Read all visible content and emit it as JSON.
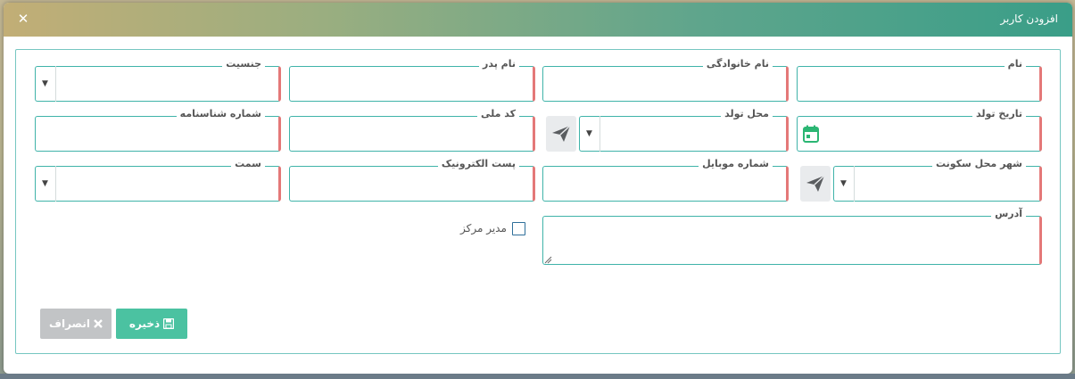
{
  "modal": {
    "title": "افزودن کاربر",
    "close_glyph": "✕"
  },
  "fields": {
    "first_name": "نام",
    "last_name": "نام خانوادگی",
    "father_name": "نام پدر",
    "gender": "جنسیت",
    "birth_date": "تاریخ تولد",
    "birth_place": "محل تولد",
    "national_code": "کد ملی",
    "id_number": "شماره شناسنامه",
    "residence_city": "شهر محل سکونت",
    "mobile": "شماره موبایل",
    "email": "پست الکترونیک",
    "position": "سمت",
    "address": "آدرس"
  },
  "dropdown_arrow": "▼",
  "checkbox": {
    "label": "مدیر مرکز",
    "checked": false
  },
  "buttons": {
    "save": "ذخیره",
    "cancel": "انصراف"
  },
  "colors": {
    "accent": "#3fb3a9",
    "required_marker": "#e47878",
    "save_button": "#4bc2a1",
    "cancel_button": "#c2c4c6",
    "calendar_icon": "#2bb673"
  },
  "icons": [
    "close-icon",
    "calendar-icon",
    "send-icon",
    "save-icon",
    "cancel-x-icon",
    "chevron-down-icon"
  ]
}
